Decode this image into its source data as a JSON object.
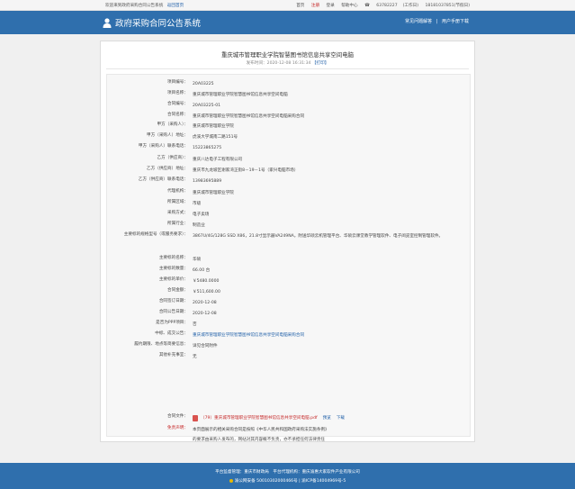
{
  "topbar": {
    "welcome": "欢迎来到政府采购合同公告系统",
    "home": "返回首页",
    "links": [
      "首页",
      "注册",
      "登录",
      "帮助中心"
    ],
    "hotline": "63782227",
    "hotline_note": "(工作日)",
    "mobile": "18181037851(节假日)"
  },
  "header": {
    "title": "政府采购合同公告系统",
    "links": [
      "常见问题解答",
      "|",
      "用户手册下载"
    ]
  },
  "card": {
    "title": "重庆城市管理职业学院智慧图书馆信息共享空间电脑",
    "publish_label": "发布时间：",
    "publish_time": "2020-12-08 16:31:34",
    "print_label": "【打印】"
  },
  "rows": [
    {
      "label": "项目编号：",
      "value": "20A03225"
    },
    {
      "label": "项目名称：",
      "value": "重庆城市管理职业学院智慧图书馆信息共享空间电脑"
    },
    {
      "label": "合同编号：",
      "value": "20A03225-01"
    },
    {
      "label": "合同名称：",
      "value": "重庆城市管理职业学院智慧图书馆信息共享空间电脑采购合同"
    },
    {
      "label": "甲方（采购人）：",
      "value": "重庆城市管理职业学院"
    },
    {
      "label": "甲方（采购人）地址：",
      "value": "虎溪大学城南二路151号"
    },
    {
      "label": "甲方（采购人）联系电话：",
      "value": "15223865275"
    },
    {
      "label": "乙方（供应商）：",
      "value": "重庆八达电子工程有限公司"
    },
    {
      "label": "乙方（供应商）地址：",
      "value": "重庆市九龙坡区谢家湾正街8－19－1号（家兴电脑市场）"
    },
    {
      "label": "乙方（供应商）联系电话：",
      "value": "13983695889"
    },
    {
      "label": "代理机构：",
      "value": "重庆城市管理职业学院"
    },
    {
      "label": "所属区域：",
      "value": "市级"
    },
    {
      "label": "采购方式：",
      "value": "电子卖场"
    },
    {
      "label": "所属行业：",
      "value": "制造业"
    },
    {
      "label": "主要标的规格型号（或服务要求）：",
      "value": "3867U/4G/128G SSD X86，21.8寸显示器VA249NA，附送华硕云机管理平台、华硕云课堂教学管理软件、电子阅览室控制管理软件。"
    },
    {
      "label": "主要标的名称：",
      "value": "华硕"
    },
    {
      "label": "主要标的数量：",
      "value": "66.00 台"
    },
    {
      "label": "主要标的单价：",
      "value": "￥5480.0000"
    },
    {
      "label": "合同金额：",
      "value": "￥511,600.00"
    },
    {
      "label": "合同签订日期：",
      "value": "2020-12-08"
    },
    {
      "label": "合同公告日期：",
      "value": "2020-12-08"
    },
    {
      "label": "是否为PPP项目：",
      "value": "否"
    },
    {
      "label": "中标、成交公告：",
      "value": "重庆城市管理职业学院智慧图书馆信息共享空间电脑采购合同",
      "link": true
    },
    {
      "label": "履约期限、地点等简要信息：",
      "value": "详见合同附件"
    },
    {
      "label": "其他补充事宜：",
      "value": "无"
    }
  ],
  "attachment": {
    "label": "合同文件：",
    "name": "（79）重庆城市管理职业学院智慧图书馆信息共享空间电脑.pdf",
    "preview": "预览",
    "download": "下载"
  },
  "notice": {
    "label": "免责声明：",
    "line1": "本页面展示的相关采购合同是按照《中华人民共和国政府采购法实施条例》",
    "line2": "的要求由采购人发布的，网站对其内容概不负责，亦不承担任何法律责任"
  },
  "footer": {
    "line1": "平台监督管理：重庆市财政局　平台代理机构：重庆渝惠大家软件产业有限公司",
    "police": "渝公网安备 50010302000466号",
    "icp": "渝ICP备14004969号-5"
  },
  "colors": {
    "brand": "#2f6fad",
    "accent_red": "#c62828",
    "link_blue": "#1f5fa8"
  }
}
